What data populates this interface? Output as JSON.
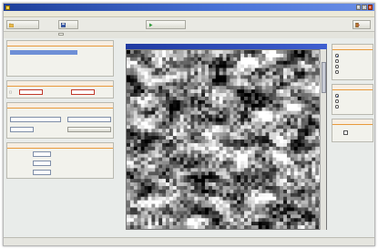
{
  "window": {
    "title": "",
    "min": "_",
    "max": "□",
    "close": "×"
  },
  "menu": [
    "",
    "",
    "",
    "",
    "",
    "",
    "",
    ""
  ],
  "toolbar": {
    "open_label": "",
    "save_label": "",
    "run_label": "",
    "exit_label": ""
  },
  "tabs": {
    "left_label": "",
    "active_tab": ""
  },
  "panels": {
    "source": {
      "title": "",
      "selected_item": "",
      "selected_value": "",
      "line2": "",
      "line3": ""
    },
    "range": {
      "title": "",
      "from": "",
      "to": ""
    },
    "settings": {
      "title": "",
      "col1": "",
      "col2": "",
      "button": ""
    },
    "params": {
      "title": "",
      "rows": [
        "",
        "",
        ""
      ]
    },
    "display": {
      "title": "",
      "options": [
        "",
        "",
        "",
        ""
      ]
    },
    "view": {
      "title": "",
      "options": [
        "",
        "",
        ""
      ]
    },
    "extra": {
      "title": ""
    }
  },
  "image": {
    "title": ""
  },
  "colors": {
    "accent": "#e89a3c",
    "titlebar": "#1e3f9a",
    "selection": "#6f8fd6"
  }
}
